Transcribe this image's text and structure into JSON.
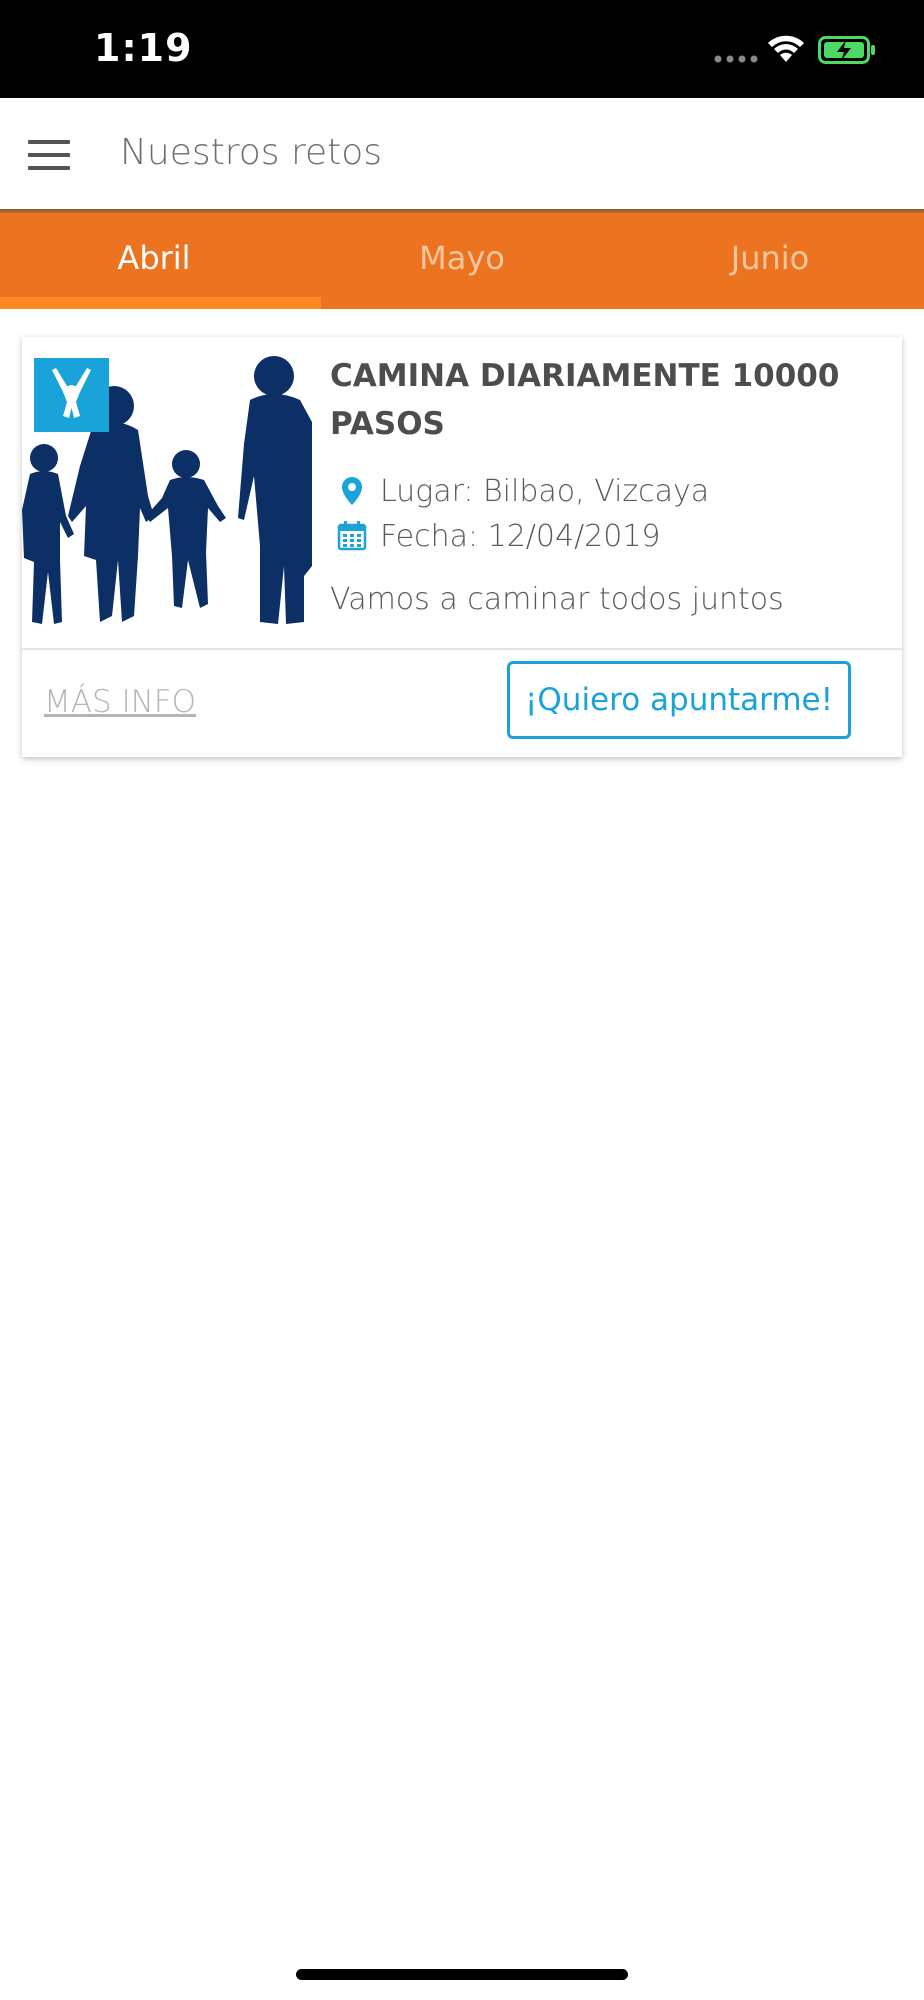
{
  "status_bar": {
    "time": "1:19",
    "icons": [
      "signal-dots-icon",
      "wifi-icon",
      "battery-charging-icon"
    ],
    "battery_color": "#4cd964"
  },
  "app_bar": {
    "menu_icon": "hamburger-menu-icon",
    "title": "Nuestros retos"
  },
  "tabs": [
    {
      "label": "Abril",
      "active": true
    },
    {
      "label": "Mayo",
      "active": false
    },
    {
      "label": "Junio",
      "active": false
    }
  ],
  "challenge": {
    "image": "family-walking-silhouette-with-logo",
    "title": "CAMINA DIARIAMENTE 10000 PASOS",
    "place": "Lugar: Bilbao, Vizcaya",
    "place_icon": "location-pin-icon",
    "date": "Fecha: 12/04/2019",
    "date_icon": "calendar-icon",
    "description": "Vamos a caminar todos juntos",
    "more_info_label": "MÁS INFO",
    "signup_label": "¡Quiero apuntarme!"
  },
  "colors": {
    "accent_orange": "#ec7421",
    "tab_indicator": "#ff8a22",
    "button_blue": "#1aa3d8",
    "silhouette_navy": "#0c2f66",
    "logo_blue": "#1aa3d8"
  }
}
